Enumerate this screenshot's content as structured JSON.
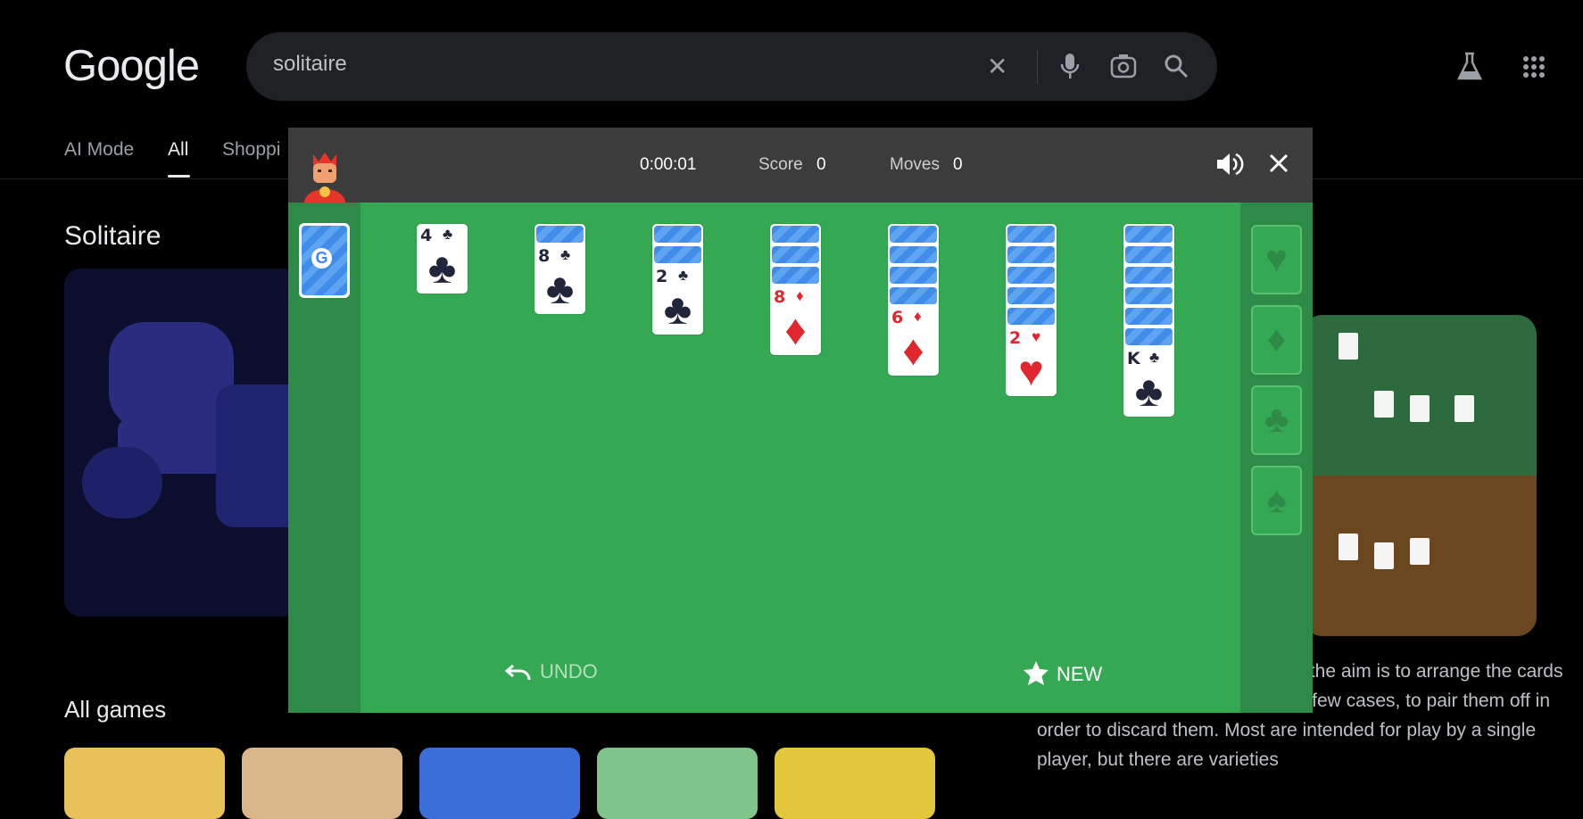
{
  "google": {
    "logo": "Google",
    "search_value": "solitaire",
    "tabs": [
      "AI Mode",
      "All",
      "Shoppi"
    ],
    "section_title": "Solitaire",
    "all_games_title": "All games",
    "side_text": "ire refer to a genre of card s that the aim is to arrange the cards in some systematic order or, in a few cases, to pair them off in order to discard them. Most are intended for play by a single player, but there are varieties"
  },
  "game": {
    "timer": "0:00:01",
    "score_label": "Score",
    "score_value": "0",
    "moves_label": "Moves",
    "moves_value": "0",
    "undo_label": "UNDO",
    "new_label": "NEW",
    "tableau": [
      {
        "hidden": 0,
        "rank": "4",
        "suit": "♣",
        "color": "black"
      },
      {
        "hidden": 1,
        "rank": "8",
        "suit": "♣",
        "color": "black"
      },
      {
        "hidden": 2,
        "rank": "2",
        "suit": "♣",
        "color": "black"
      },
      {
        "hidden": 3,
        "rank": "8",
        "suit": "♦",
        "color": "red"
      },
      {
        "hidden": 4,
        "rank": "6",
        "suit": "♦",
        "color": "red"
      },
      {
        "hidden": 5,
        "rank": "2",
        "suit": "♥",
        "color": "red"
      },
      {
        "hidden": 6,
        "rank": "K",
        "suit": "♣",
        "color": "black"
      }
    ],
    "foundations": [
      "♥",
      "♦",
      "♣",
      "♠"
    ],
    "colors": {
      "felt": "#34a853",
      "column": "#2e8b47",
      "topbar": "#3c3c3c",
      "card_back": "#3f8de8"
    }
  }
}
